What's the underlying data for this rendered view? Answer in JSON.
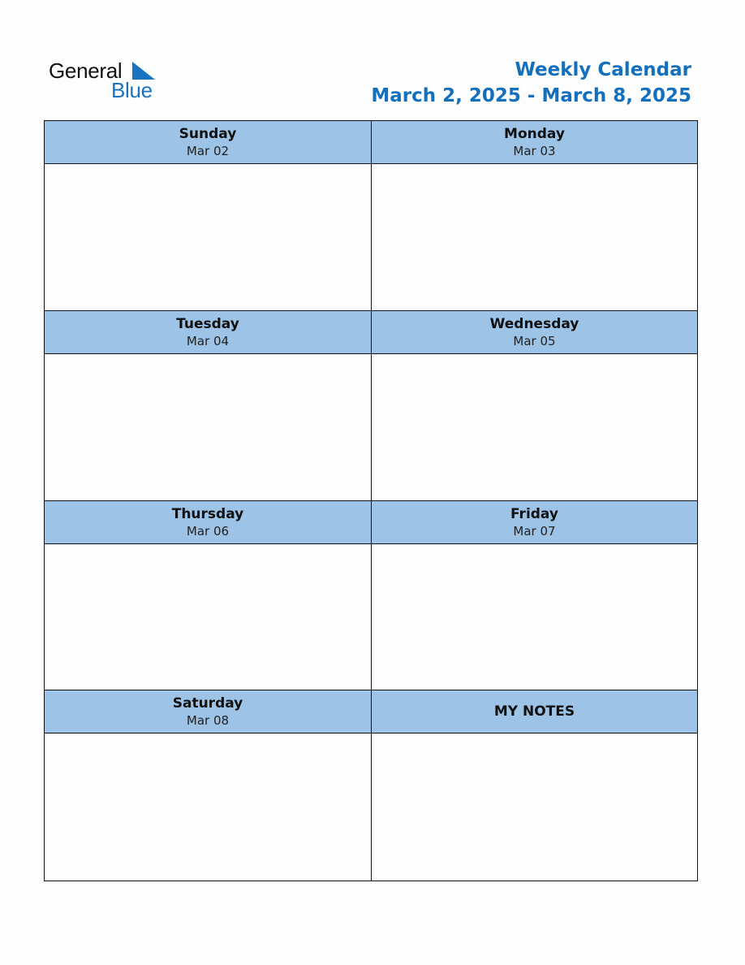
{
  "logo": {
    "line1": "General",
    "line2": "Blue",
    "brand_color": "#1a73c0"
  },
  "header": {
    "title": "Weekly Calendar",
    "range": "March 2, 2025 - March 8, 2025",
    "title_color": "#1470bd"
  },
  "days": [
    {
      "name": "Sunday",
      "date": "Mar 02"
    },
    {
      "name": "Monday",
      "date": "Mar 03"
    },
    {
      "name": "Tuesday",
      "date": "Mar 04"
    },
    {
      "name": "Wednesday",
      "date": "Mar 05"
    },
    {
      "name": "Thursday",
      "date": "Mar 06"
    },
    {
      "name": "Friday",
      "date": "Mar 07"
    },
    {
      "name": "Saturday",
      "date": "Mar 08"
    }
  ],
  "notes": {
    "title": "MY NOTES"
  },
  "colors": {
    "header_fill": "#9dc3e6",
    "border": "#111111"
  }
}
